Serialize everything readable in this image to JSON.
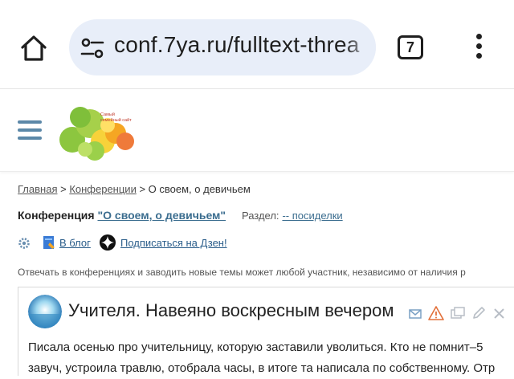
{
  "browser": {
    "url": "conf.7ya.ru/fulltext-threa",
    "tab_count": "7"
  },
  "logo": {
    "tagline_line1": "Самый",
    "tagline_line2": "семейный сайт"
  },
  "breadcrumb": {
    "home": "Главная",
    "sep1": " > ",
    "conferences": "Конференции",
    "sep2": " > ",
    "current": "О своем, о девичьем"
  },
  "conference": {
    "label": "Конференция",
    "name": "\"О своем, о девичьем\"",
    "section_label": "Раздел:",
    "section_value": "-- посиделки"
  },
  "tools": {
    "blog_label": "В блог",
    "dzen_label": "Подписаться на Дзен!"
  },
  "notice": "Отвечать в конференциях и заводить новые темы может любой участник, независимо от наличия р",
  "post": {
    "title": "Учителя. Навеяно воскресным вечером",
    "line1": "Писала осенью про учительницу, которую заставили уволиться. Кто не помнит–5",
    "line2": "завуч, устроила травлю, отобрала часы, в итоге та написала по собственному. Отр"
  },
  "colors": {
    "urlbar_bg": "#e8eef9",
    "link": "#3b6d8f",
    "hamburger": "#5b88a8",
    "warning": "#e2703a"
  }
}
